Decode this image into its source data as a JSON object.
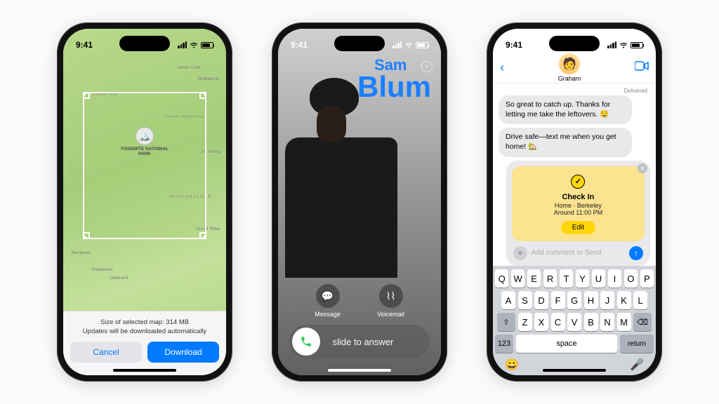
{
  "status": {
    "time": "9:41"
  },
  "maps": {
    "park": "YOSEMITE NATIONAL PARK",
    "labels": {
      "devilsGate": "Devils Gate",
      "bridgeport": "Bridgeport",
      "leavittPeak": "Leavitt Peak",
      "hooverWilderness": "Hoover Wilderness",
      "leeVining": "Lee Vining",
      "mountLyell": "Mount Lyell 13,114 ft",
      "mountRitter": "Mount Ritter",
      "mariposa": "Mariposa",
      "ahwahnee": "Ahwahnee",
      "oakhurst": "Oakhurst"
    },
    "sheet_line1": "Size of selected map: 314 MB",
    "sheet_line2": "Updates will be downloaded automatically",
    "cancel": "Cancel",
    "download": "Download"
  },
  "call": {
    "first": "Sam",
    "last": "Blum",
    "message": "Message",
    "voicemail": "Voicemail",
    "slide": "slide to answer"
  },
  "messages": {
    "contact": "Graham",
    "delivered": "Delivered",
    "msg1": "So great to catch up. Thanks for letting me take the leftovers. 🤤",
    "msg2": "Drive safe—text me when you get home! 🏡",
    "checkin": {
      "title": "Check In",
      "sub1": "Home · Berkeley",
      "sub2": "Around 11:00 PM",
      "edit": "Edit"
    },
    "placeholder": "Add comment or Send",
    "keys": {
      "r1": [
        "Q",
        "W",
        "E",
        "R",
        "T",
        "Y",
        "U",
        "I",
        "O",
        "P"
      ],
      "r2": [
        "A",
        "S",
        "D",
        "F",
        "G",
        "H",
        "J",
        "K",
        "L"
      ],
      "r3": [
        "Z",
        "X",
        "C",
        "V",
        "B",
        "N",
        "M"
      ],
      "num": "123",
      "space": "space",
      "return": "return"
    }
  }
}
